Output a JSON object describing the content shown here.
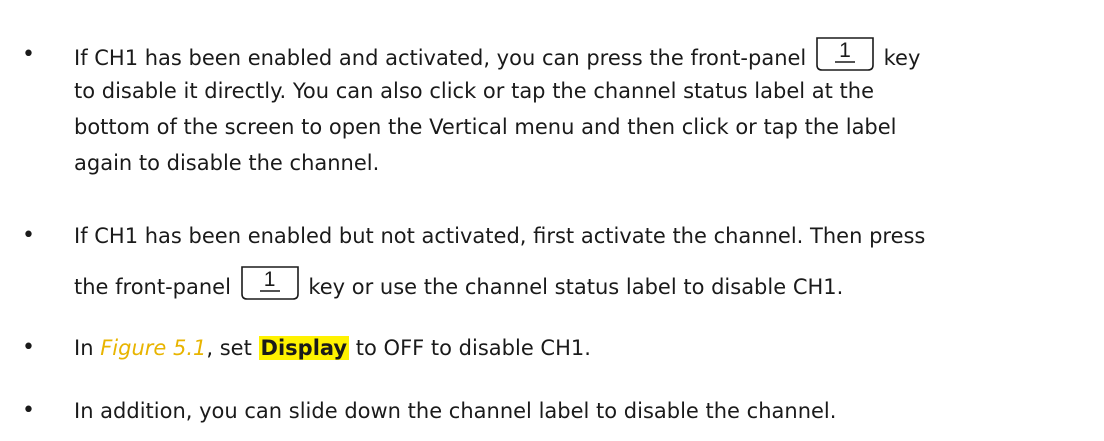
{
  "items": [
    {
      "bullet": "•",
      "line1_a": "If CH1 has been enabled and activated, you can press the front-panel",
      "key": "1",
      "line1_b": "key",
      "line2": "to disable it directly. You can also click or tap the channel status label at the",
      "line3": "bottom of the screen to open the Vertical menu and then click or tap the label",
      "line4": "again to disable the channel."
    },
    {
      "bullet": "•",
      "line1": "If CH1 has been enabled but not activated, first activate the channel. Then press",
      "line2_a": "the front-panel",
      "key": "1",
      "line2_b": "key or use the channel status label to disable CH1."
    },
    {
      "bullet": "•",
      "pre": "In",
      "figure_ref": "Figure 5.1",
      "mid": ", set",
      "highlight": "Display",
      "post": "to OFF to disable CH1."
    },
    {
      "bullet": "•",
      "text": "In addition, you can slide down the channel label to disable the channel."
    }
  ],
  "colors": {
    "figure_ref": "#e8b400",
    "highlight_bg": "#fff200",
    "text": "#1a1a1a"
  }
}
